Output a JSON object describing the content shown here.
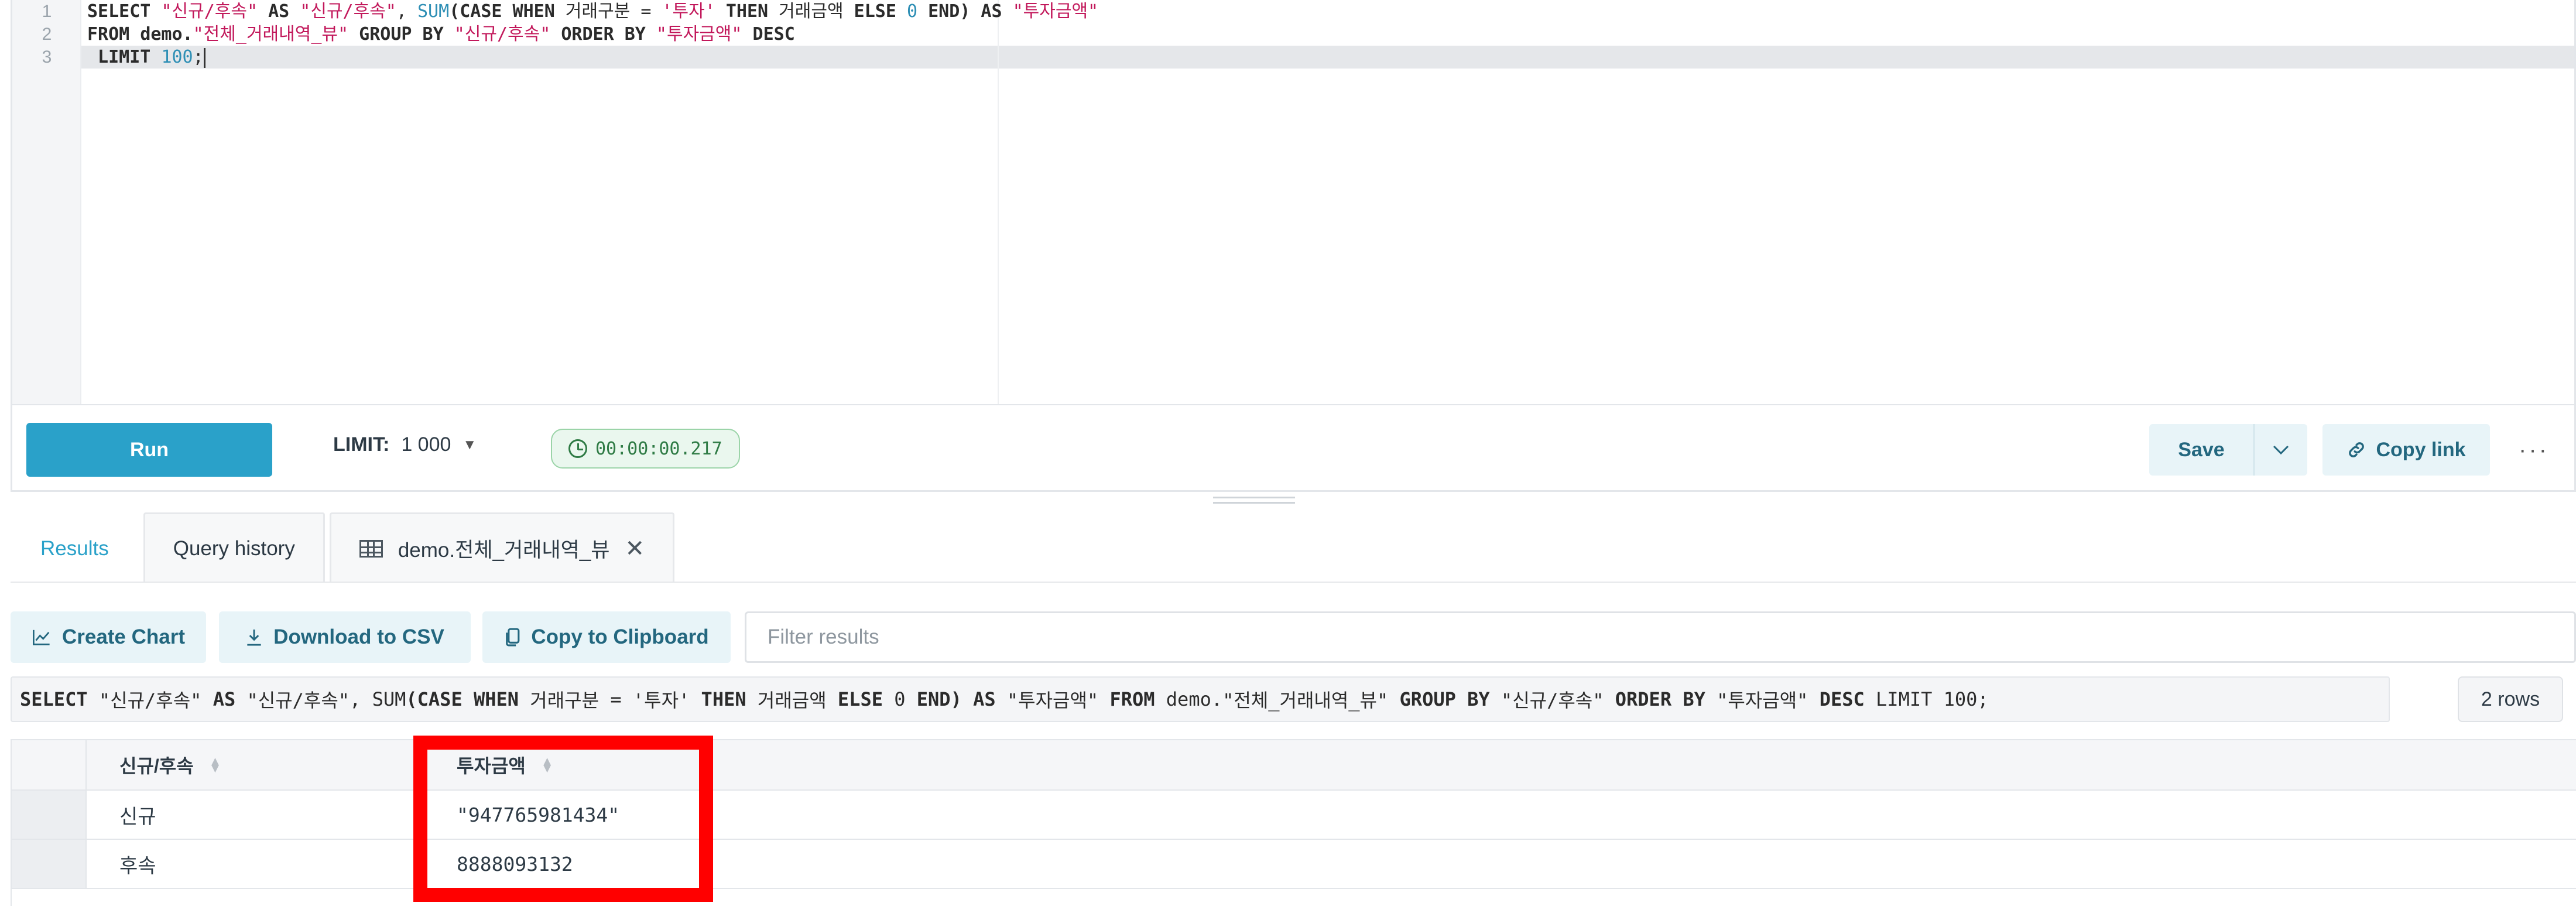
{
  "editor": {
    "line_numbers": [
      "1",
      "2",
      "3"
    ],
    "line1": {
      "t1": "SELECT ",
      "t2": "\"신규/후속\"",
      "t3": " AS ",
      "t4": "\"신규/후속\"",
      "t5": ", ",
      "t6": "SUM",
      "t7": "(CASE WHEN ",
      "t8": "거래구분",
      "t9": " = ",
      "t10": "'투자'",
      "t11": " THEN ",
      "t12": "거래금액",
      "t13": " ELSE ",
      "t14": "0",
      "t15": " END) AS ",
      "t16": "\"투자금액\""
    },
    "line2": {
      "t1": "FROM ",
      "t2": "demo.",
      "t3": "\"전체_거래내역_뷰\"",
      "t4": " GROUP BY ",
      "t5": "\"신규/후속\"",
      "t6": " ORDER BY ",
      "t7": "\"투자금액\"",
      "t8": " DESC"
    },
    "line3": {
      "t1": " LIMIT ",
      "t2": "100",
      "t3": ";"
    }
  },
  "toolbar": {
    "run_label": "Run",
    "limit_label": "LIMIT:",
    "limit_value": "1 000",
    "timer": "00:00:00.217",
    "save_label": "Save",
    "copy_link_label": "Copy link",
    "more_label": "···"
  },
  "tabs": [
    {
      "label": "Results",
      "active": true
    },
    {
      "label": "Query history",
      "active": false
    },
    {
      "label": "demo.전체_거래내역_뷰",
      "active": false
    }
  ],
  "actions": {
    "create_chart": "Create Chart",
    "download_csv": "Download to CSV",
    "copy_clipboard": "Copy to Clipboard",
    "filter_placeholder": "Filter results"
  },
  "sql_strip": {
    "t1": "SELECT ",
    "t2": "\"신규/후속\"",
    "t3": " AS ",
    "t4": "\"신규/후속\"",
    "t5": ", ",
    "t6": "SUM",
    "t7": "(CASE WHEN ",
    "t8": "거래구분",
    "t9": " = ",
    "t10": "'투자'",
    "t11": " THEN ",
    "t12": "거래금액",
    "t13": " ELSE ",
    "t14": "0",
    "t15": " END) AS ",
    "t16": "\"투자금액\"",
    "t17": " FROM ",
    "t18": "demo",
    "t19": ".",
    "t20": "\"전체_거래내역_뷰\"",
    "t21": " GROUP BY ",
    "t22": "\"신규/후속\"",
    "t23": " ORDER BY ",
    "t24": "\"투자금액\"",
    "t25": " DESC ",
    "t26": "LIMIT ",
    "t27": "100",
    "t28": ";"
  },
  "rows_badge": "2 rows",
  "table": {
    "columns": [
      "신규/후속",
      "투자금액"
    ],
    "rows": [
      [
        "신규",
        "\"947765981434\""
      ],
      [
        "후속",
        "8888093132"
      ]
    ]
  },
  "colors": {
    "accent": "#2aa1c9",
    "highlight": "#ff0000",
    "timer_green": "#2f7b45"
  }
}
